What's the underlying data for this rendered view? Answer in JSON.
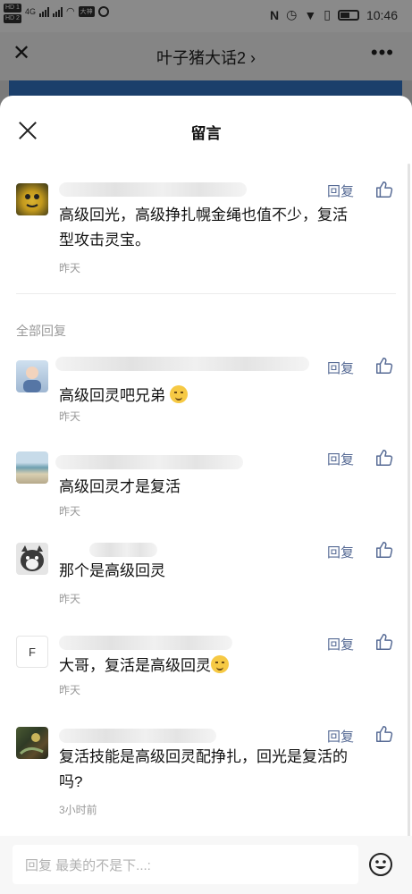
{
  "status_bar": {
    "hd_labels": [
      "HD 1",
      "HD 2"
    ],
    "network": "4G",
    "app_badge": "大神",
    "time": "10:46"
  },
  "article": {
    "title": "叶子猪大话2 ›"
  },
  "modal": {
    "title": "留言"
  },
  "top_comment": {
    "reply_label": "回复",
    "text_line1": "高级回光，高级挣扎幌金绳也值不少，复活",
    "text_line2": "型攻击灵宝。",
    "time": "昨天"
  },
  "section": {
    "label": "全部回复"
  },
  "replies": [
    {
      "reply_label": "回复",
      "text": "高级回灵吧兄弟",
      "time": "昨天"
    },
    {
      "reply_label": "回复",
      "text": "高级回灵才是复活",
      "time": "昨天"
    },
    {
      "reply_label": "回复",
      "text": "那个是高级回灵",
      "time": "昨天"
    },
    {
      "reply_label": "回复",
      "avatar_letter": "F",
      "text": "大哥，复活是高级回灵",
      "time": "昨天"
    },
    {
      "reply_label": "回复",
      "text_line1": "复活技能是高级回灵配挣扎，回光是复活的",
      "text_line2": "吗?",
      "time": "3小时前"
    }
  ],
  "input": {
    "placeholder": "回复 最美的不是下...:"
  },
  "colors": {
    "link": "#576b95",
    "muted": "#999999",
    "banner": "#1b3f6b"
  },
  "icons": [
    "close-icon",
    "more-icon",
    "like-icon",
    "emoji-icon"
  ]
}
